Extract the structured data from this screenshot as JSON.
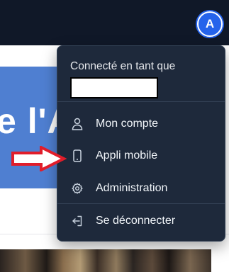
{
  "header": {
    "avatar_initial": "A"
  },
  "background": {
    "banner_text": "e l'A"
  },
  "menu": {
    "connected_label": "Connecté en tant que",
    "items": [
      {
        "label": "Mon compte",
        "icon": "user-icon"
      },
      {
        "label": "Appli mobile",
        "icon": "smartphone-icon"
      },
      {
        "label": "Administration",
        "icon": "settings-icon"
      },
      {
        "label": "Se déconnecter",
        "icon": "logout-icon"
      }
    ]
  },
  "colors": {
    "topbar": "#101828",
    "menu_bg": "#1e293b",
    "avatar": "#2563eb",
    "banner": "#4f7fd1",
    "annotation_arrow": "#e11d2a"
  }
}
